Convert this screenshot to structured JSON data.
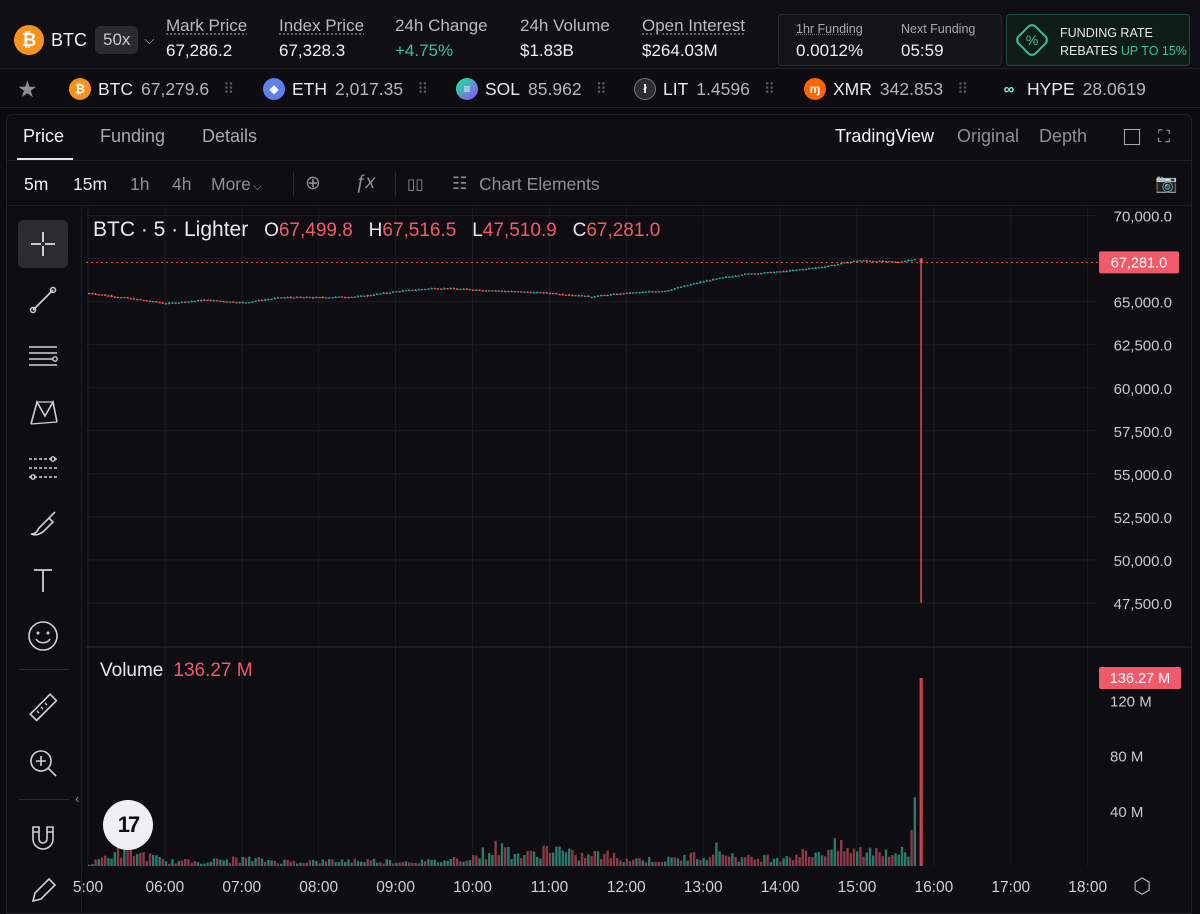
{
  "header": {
    "asset": "BTC",
    "asset_icon": "₿",
    "leverage": "50x",
    "stats": [
      {
        "label": "Mark Price",
        "value": "67,286.2",
        "underline": true
      },
      {
        "label": "Index Price",
        "value": "67,328.3",
        "underline": true
      },
      {
        "label": "24h Change",
        "value": "+4.75%",
        "underline": false
      },
      {
        "label": "24h Volume",
        "value": "$1.83B",
        "underline": false
      },
      {
        "label": "Open Interest",
        "value": "$264.03M",
        "underline": true
      }
    ],
    "funding": {
      "label": "1hr Funding",
      "value": "0.0012%"
    },
    "next_funding": {
      "label": "Next Funding",
      "value": "05:59"
    },
    "rebate": {
      "line1": "FUNDING RATE",
      "line2_prefix": "REBATES ",
      "line2_highlight": "UP TO 15%"
    }
  },
  "ticker": [
    {
      "symbol": "BTC",
      "price": "67,279.6",
      "icon": "₿",
      "color": "#f7931a"
    },
    {
      "symbol": "ETH",
      "price": "2,017.35",
      "icon": "◆",
      "color": "#627eea"
    },
    {
      "symbol": "SOL",
      "price": "85.962",
      "icon": "≡",
      "color": "#9b4dff"
    },
    {
      "symbol": "LIT",
      "price": "1.4596",
      "icon": "ł",
      "color": "#2c2c34"
    },
    {
      "symbol": "XMR",
      "price": "342.853",
      "icon": "ɱ",
      "color": "#ff6600"
    },
    {
      "symbol": "HYPE",
      "price": "28.0619",
      "icon": "∞",
      "color": "#0d0d11"
    }
  ],
  "tabs": [
    "Price",
    "Funding",
    "Details"
  ],
  "views": [
    "TradingView",
    "Original",
    "Depth"
  ],
  "timeframes": [
    "5m",
    "15m",
    "1h",
    "4h",
    "More"
  ],
  "toolbar": {
    "chart_elements": "Chart Elements"
  },
  "legend": {
    "title": "BTC · 5 · Lighter",
    "o_key": "O",
    "o": "67,499.8",
    "h_key": "H",
    "h": "67,516.5",
    "l_key": "L",
    "l": "47,510.9",
    "c_key": "C",
    "c": "67,281.0"
  },
  "volume_legend": {
    "label": "Volume",
    "value": "136.27 M"
  },
  "tv_logo": "17",
  "chart_data": {
    "type": "candlestick",
    "symbol": "BTC · 5 · Lighter",
    "price_axis_ticks": [
      "70,000.0",
      "67,500.0",
      "65,000.0",
      "62,500.0",
      "60,000.0",
      "57,500.0",
      "55,000.0",
      "52,500.0",
      "50,000.0",
      "47,500.0"
    ],
    "price_ylim": [
      45000,
      70500
    ],
    "last_price_label": "67,281.0",
    "last_price": 67281.0,
    "time_ticks": [
      "5:00",
      "06:00",
      "07:00",
      "08:00",
      "09:00",
      "10:00",
      "11:00",
      "12:00",
      "13:00",
      "14:00",
      "15:00",
      "16:00",
      "17:00",
      "18:00"
    ],
    "price_trend": [
      [
        "5:00",
        65500
      ],
      [
        "5:30",
        65200
      ],
      [
        "06:00",
        64900
      ],
      [
        "06:30",
        65100
      ],
      [
        "07:00",
        64950
      ],
      [
        "07:30",
        65250
      ],
      [
        "08:00",
        65250
      ],
      [
        "08:30",
        65300
      ],
      [
        "09:00",
        65600
      ],
      [
        "09:30",
        65800
      ],
      [
        "10:00",
        65700
      ],
      [
        "10:30",
        65600
      ],
      [
        "11:00",
        65500
      ],
      [
        "11:30",
        65300
      ],
      [
        "12:00",
        65500
      ],
      [
        "12:30",
        65650
      ],
      [
        "13:00",
        66200
      ],
      [
        "13:30",
        66600
      ],
      [
        "14:00",
        66750
      ],
      [
        "14:30",
        67000
      ],
      [
        "15:00",
        67400
      ],
      [
        "15:30",
        67300
      ],
      [
        "15:45",
        67500
      ]
    ],
    "spike": {
      "time": "15:50",
      "open": 67499.8,
      "high": 67516.5,
      "low": 47510.9,
      "close": 67281.0
    },
    "volume_axis_ticks": [
      "120 M",
      "80 M",
      "40 M"
    ],
    "volume_ylim": [
      0,
      145
    ],
    "last_volume_label": "136.27 M",
    "last_volume": 136.27,
    "volume_series_millions": [
      [
        "5:00",
        1
      ],
      [
        "5:20",
        12
      ],
      [
        "5:30",
        14
      ],
      [
        "5:40",
        10
      ],
      [
        "06:00",
        4
      ],
      [
        "06:30",
        4
      ],
      [
        "07:00",
        6
      ],
      [
        "07:30",
        4
      ],
      [
        "08:00",
        4
      ],
      [
        "08:30",
        5
      ],
      [
        "09:00",
        4
      ],
      [
        "09:30",
        4
      ],
      [
        "10:00",
        8
      ],
      [
        "10:20",
        16
      ],
      [
        "10:40",
        8
      ],
      [
        "11:00",
        16
      ],
      [
        "11:20",
        8
      ],
      [
        "11:40",
        10
      ],
      [
        "12:00",
        6
      ],
      [
        "12:30",
        5
      ],
      [
        "13:00",
        10
      ],
      [
        "13:10",
        14
      ],
      [
        "13:30",
        6
      ],
      [
        "14:00",
        8
      ],
      [
        "14:30",
        12
      ],
      [
        "14:40",
        16
      ],
      [
        "15:00",
        12
      ],
      [
        "15:20",
        14
      ],
      [
        "15:40",
        10
      ],
      [
        "15:50",
        136.27
      ]
    ]
  },
  "colors": {
    "up": "#26a69a",
    "down": "#ef5350",
    "accent_green": "#3ec08e",
    "label_red": "#f05a6a"
  }
}
